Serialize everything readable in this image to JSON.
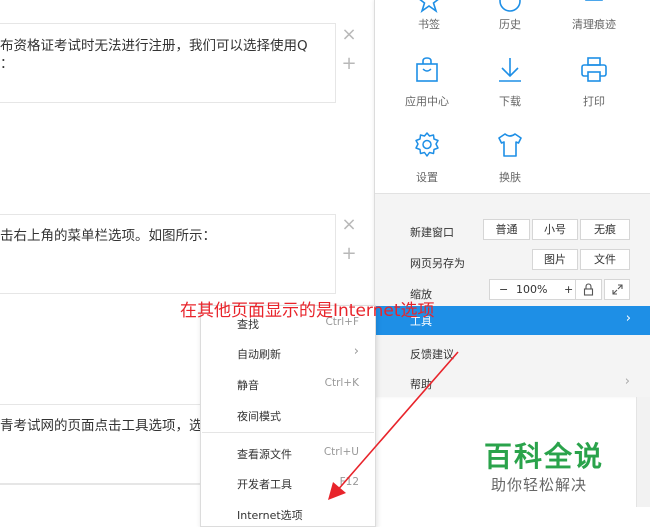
{
  "article": {
    "blocks": [
      {
        "line1": "布资格证考试时无法进行注册，我们可以选择使用Q",
        "line2": "："
      },
      {
        "line1": "击右上角的菜单栏选项。如图所示：",
        "line2": ""
      },
      {
        "line1": "青考试网的页面点击工具选项，选",
        "line2": ""
      }
    ],
    "close_glyph": "×",
    "add_glyph": "+"
  },
  "menu": {
    "grid": [
      {
        "label": "书签",
        "icon": "star-icon"
      },
      {
        "label": "历史",
        "icon": "clock-icon"
      },
      {
        "label": "清理痕迹",
        "icon": "trash-icon"
      },
      {
        "label": "应用中心",
        "icon": "bag-icon"
      },
      {
        "label": "下载",
        "icon": "download-icon"
      },
      {
        "label": "打印",
        "icon": "printer-icon"
      },
      {
        "label": "设置",
        "icon": "gear-icon"
      },
      {
        "label": "换肤",
        "icon": "tshirt-icon"
      }
    ],
    "new_window": {
      "label": "新建窗口",
      "options": [
        "普通",
        "小号",
        "无痕"
      ]
    },
    "save_as": {
      "label": "网页另存为",
      "options": [
        "图片",
        "文件"
      ]
    },
    "zoom": {
      "label": "缩放",
      "minus": "−",
      "value": "100%",
      "plus": "+"
    },
    "tools": {
      "label": "工具",
      "chevron": "›"
    },
    "feedback": {
      "label": "反馈建议"
    },
    "help": {
      "label": "帮助",
      "chevron": "›"
    },
    "accent_color": "#1e8fe6"
  },
  "submenu": {
    "items": [
      {
        "label": "查找",
        "shortcut": "Ctrl+F"
      },
      {
        "label": "自动刷新",
        "shortcut": "›"
      },
      {
        "label": "静音",
        "shortcut": "Ctrl+K"
      },
      {
        "label": "夜间模式",
        "shortcut": ""
      },
      {
        "label": "查看源文件",
        "shortcut": "Ctrl+U"
      },
      {
        "label": "开发者工具",
        "shortcut": "F12"
      },
      {
        "label": "Internet选项",
        "shortcut": ""
      }
    ]
  },
  "annotation": {
    "text": "在其他页面显示的是Internet选项",
    "color": "#e8242b"
  },
  "watermark": {
    "main": "百科全说",
    "sub": "助你轻松解决",
    "color": "#2aa34b"
  }
}
